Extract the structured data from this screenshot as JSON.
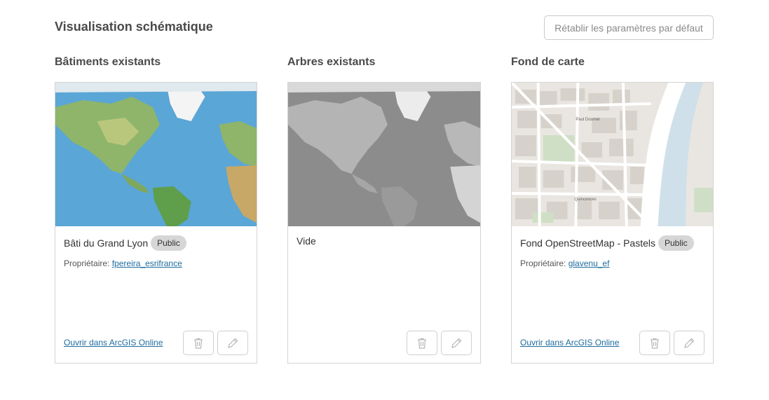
{
  "header": {
    "title": "Visualisation schématique",
    "reset_label": "Rétablir les paramètres par défaut"
  },
  "columns": [
    {
      "title": "Bâtiments existants",
      "card": {
        "name": "Bâti du Grand Lyon",
        "badge": "Public",
        "owner_label": "Propriétaire:",
        "owner": "fpereira_esrifrance",
        "open_label": "Ouvrir dans ArcGIS Online",
        "thumbnail": "world-imagery-map"
      }
    },
    {
      "title": "Arbres existants",
      "card": {
        "name": "Vide",
        "thumbnail": "world-grayscale-map"
      }
    },
    {
      "title": "Fond de carte",
      "card": {
        "name": "Fond OpenStreetMap - Pastels",
        "badge": "Public",
        "owner_label": "Propriétaire:",
        "owner": "glavenu_ef",
        "open_label": "Ouvrir dans ArcGIS Online",
        "thumbnail": "city-street-map",
        "map_labels": [
          "Paul Doumer",
          "Quinconces"
        ]
      }
    }
  ],
  "icons": {
    "delete": "trash-icon",
    "edit": "pencil-icon"
  },
  "colors": {
    "link": "#1f6c9e",
    "badge_bg": "#d6d6d6",
    "ocean": "#5aa6d6"
  }
}
